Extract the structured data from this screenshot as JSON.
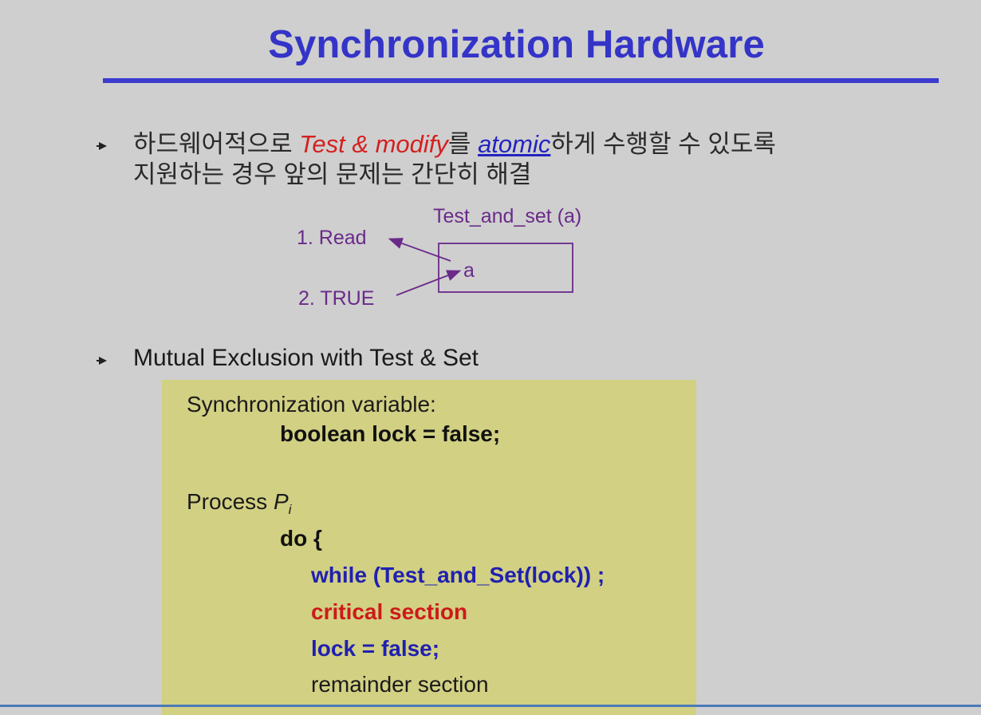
{
  "slide": {
    "title": "Synchronization Hardware",
    "title_color": "#3434c8"
  },
  "bullet1": {
    "part1": "하드웨어적으로 ",
    "test_modify": "Test & modify",
    "part2": "를 ",
    "atomic": "atomic",
    "part3": "하게 수행할 수 있도록",
    "line2": "지원하는 경우 앞의 문제는 간단히 해결"
  },
  "diagram": {
    "label_title": "Test_and_set (a)",
    "label_read": "1. Read",
    "label_true": "2. TRUE",
    "box_label": "a"
  },
  "bullet2": {
    "text": "Mutual Exclusion with Test & Set"
  },
  "code": {
    "sync_var_label": "Synchronization variable:",
    "sync_var_decl": "boolean lock = false;",
    "process_label": "Process ",
    "process_p": "P",
    "process_sub": "i",
    "do_open": "do {",
    "while_line": "while (Test_and_Set(lock)) ;",
    "critical": "critical section",
    "lock_false": "lock = false;",
    "remainder": "remainder section"
  },
  "colors": {
    "background": "#cfcfcf",
    "code_box": "#d2d083",
    "diagram_purple": "#6a2a8a",
    "highlight_red": "#d42020",
    "highlight_blue": "#2424c0"
  }
}
